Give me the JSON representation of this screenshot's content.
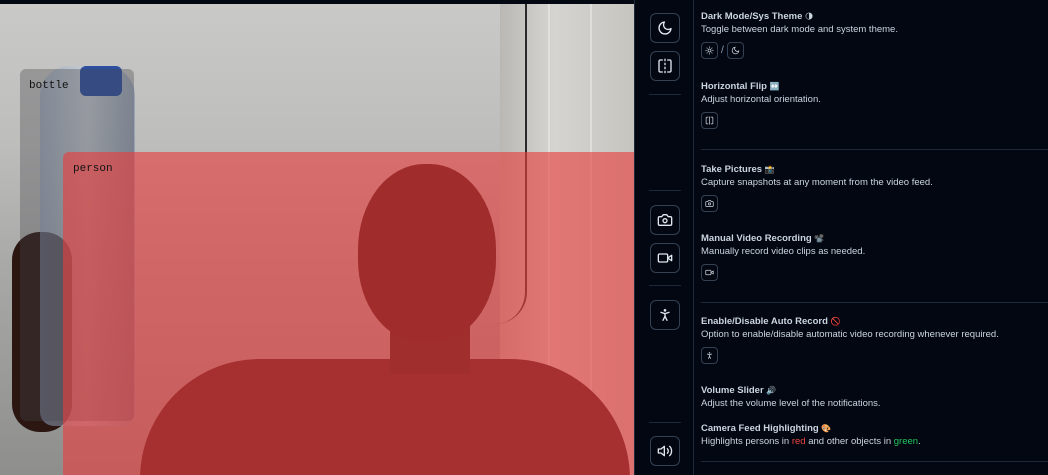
{
  "feed": {
    "detections": [
      {
        "label": "bottle"
      },
      {
        "label": "person"
      }
    ]
  },
  "toolbar": {
    "buttons": [
      {
        "icon": "moon-icon"
      },
      {
        "icon": "flip-horizontal-icon"
      },
      {
        "icon": "camera-icon"
      },
      {
        "icon": "video-icon"
      },
      {
        "icon": "person-standing-icon"
      },
      {
        "icon": "volume-icon"
      }
    ]
  },
  "panel": {
    "sections": [
      {
        "title": "Dark Mode/Sys Theme",
        "emoji": "🌗",
        "desc": "Toggle between dark mode and system theme.",
        "sep": "/"
      },
      {
        "title": "Horizontal Flip",
        "emoji": "↔️",
        "desc": "Adjust horizontal orientation."
      },
      {
        "title": "Take Pictures",
        "emoji": "📸",
        "desc": "Capture snapshots at any moment from the video feed."
      },
      {
        "title": "Manual Video Recording",
        "emoji": "📽️",
        "desc": "Manually record video clips as needed."
      },
      {
        "title": "Enable/Disable Auto Record",
        "emoji": "🚫",
        "desc": "Option to enable/disable automatic video recording whenever required."
      },
      {
        "title": "Volume Slider",
        "emoji": "🔊",
        "desc": "Adjust the volume level of the notifications."
      },
      {
        "title": "Camera Feed Highlighting",
        "emoji": "🎨",
        "desc_prefix": "Highlights persons in",
        "desc_red": "red",
        "desc_mid": "and other objects in",
        "desc_green": "green",
        "desc_suffix": "."
      }
    ]
  },
  "colors": {
    "background": "#030711",
    "border": "#1e293b",
    "person_highlight": "#e83e3e",
    "highlight_red": "#ef4444",
    "highlight_green": "#22c55e"
  }
}
